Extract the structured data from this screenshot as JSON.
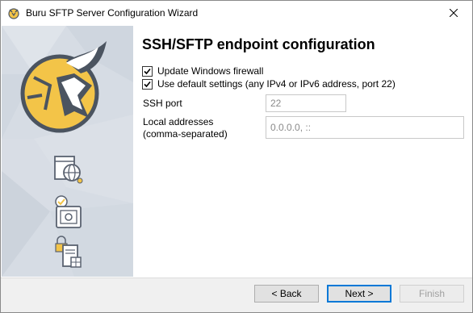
{
  "window": {
    "title": "Buru SFTP Server Configuration Wizard"
  },
  "page": {
    "heading": "SSH/SFTP endpoint configuration",
    "firewall_label": "Update Windows firewall",
    "firewall_checked": true,
    "defaults_label": "Use default settings (any IPv4 or IPv6 address, port 22)",
    "defaults_checked": true,
    "ssh_port_label": "SSH port",
    "ssh_port_value": "22",
    "local_addresses_label_line1": "Local addresses",
    "local_addresses_label_line2": "(comma-separated)",
    "local_addresses_placeholder": "0.0.0.0, ::"
  },
  "buttons": {
    "back": "< Back",
    "next": "Next >",
    "finish": "Finish"
  },
  "colors": {
    "accent": "#0078d7",
    "sidebar": "#d4dae2",
    "logo_gold": "#f3c448",
    "logo_dark": "#4b5460"
  }
}
